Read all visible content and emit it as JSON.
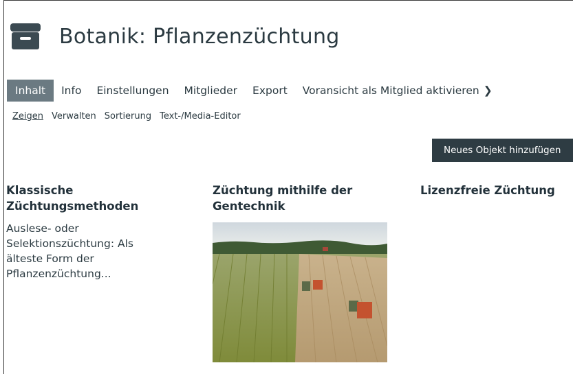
{
  "header": {
    "title": "Botanik: Pflanzenzüchtung",
    "icon": "archive-box-icon"
  },
  "tabs": [
    {
      "label": "Inhalt",
      "active": true
    },
    {
      "label": "Info"
    },
    {
      "label": "Einstellungen"
    },
    {
      "label": "Mitglieder"
    },
    {
      "label": "Export"
    },
    {
      "label": "Voransicht als Mitglied aktivieren"
    }
  ],
  "subnav": [
    {
      "label": "Zeigen",
      "active": true
    },
    {
      "label": "Verwalten"
    },
    {
      "label": "Sortierung"
    },
    {
      "label": "Text-/Media-Editor"
    }
  ],
  "add_button": "Neues Objekt hinzufügen",
  "cards": [
    {
      "title": "Klassische Züchtungsmethoden",
      "text": "Auslese- oder Selektionszüchtung: Als älteste Form der Pflanzenzüchtung..."
    },
    {
      "title": "Züchtung mithilfe der Gentechnik",
      "image": "field-harvest-photo"
    },
    {
      "title": "Lizenzfreie Züchtung"
    }
  ],
  "colors": {
    "active_tab": "#6b7a82",
    "button_bg": "#2e3c43",
    "text": "#2b3a41"
  }
}
